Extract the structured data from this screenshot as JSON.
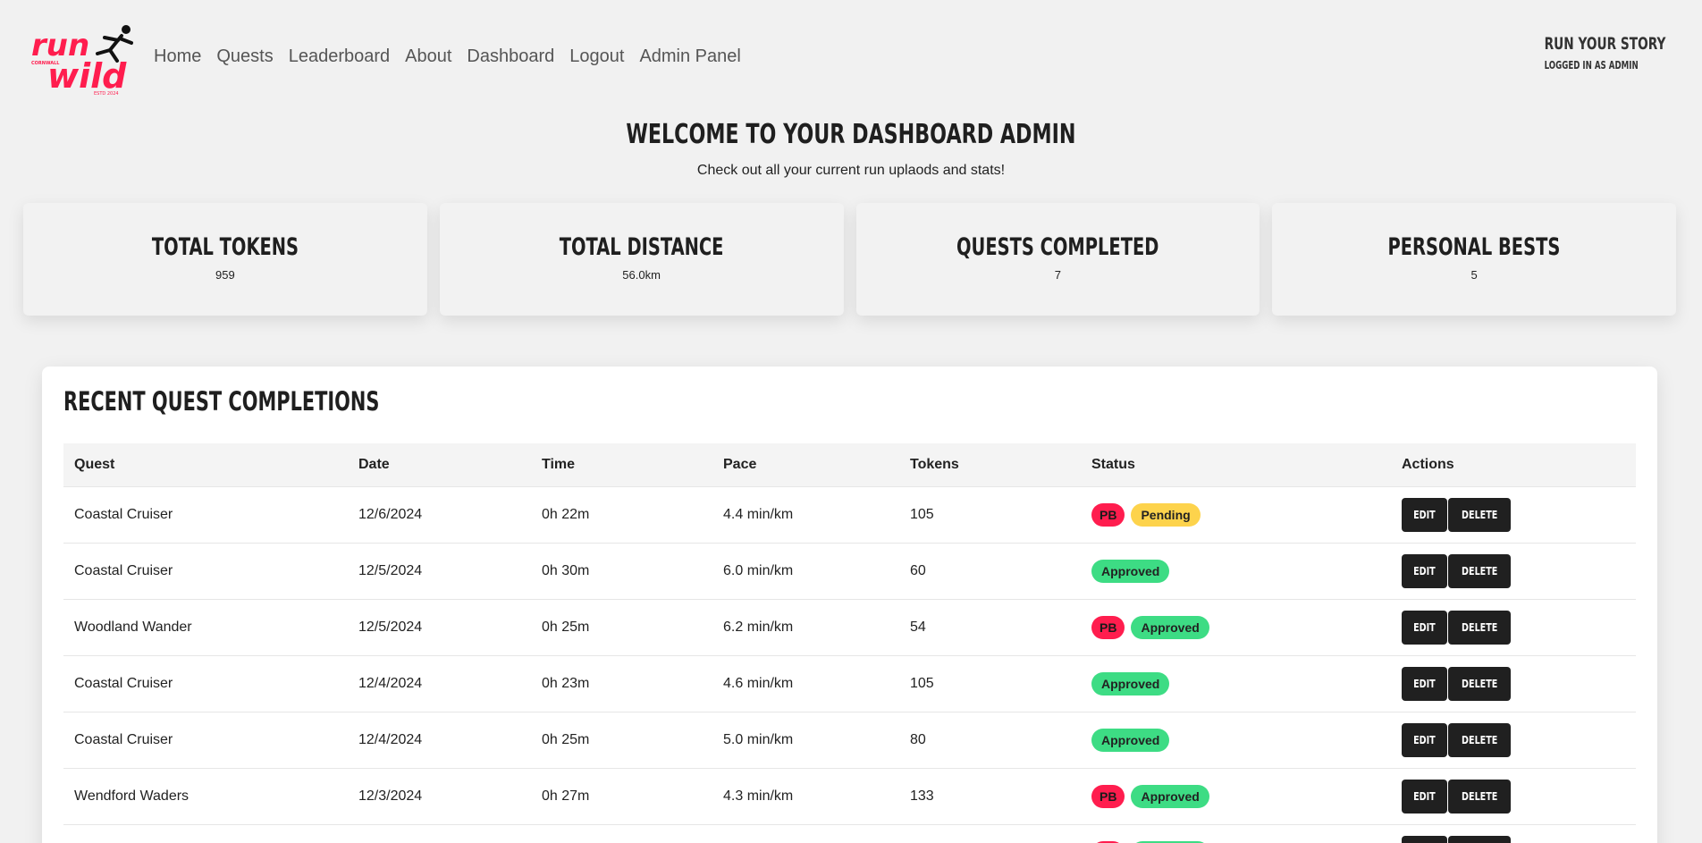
{
  "header": {
    "logo": {
      "line1": "run",
      "line2": "wild",
      "small_top": "CORNWALL",
      "small_bottom": "ESTD 2024"
    },
    "nav": [
      "Home",
      "Quests",
      "Leaderboard",
      "About",
      "Dashboard",
      "Logout",
      "Admin Panel"
    ],
    "brand_title": "RUN YOUR STORY",
    "brand_sub": "LOGGED IN AS ADMIN"
  },
  "welcome": {
    "title": "WELCOME TO YOUR DASHBOARD ADMIN",
    "subtitle": "Check out all your current run uplaods and stats!"
  },
  "stats": [
    {
      "label": "TOTAL TOKENS",
      "value": "959"
    },
    {
      "label": "TOTAL DISTANCE",
      "value": "56.0km"
    },
    {
      "label": "QUESTS COMPLETED",
      "value": "7"
    },
    {
      "label": "PERSONAL BESTS",
      "value": "5"
    }
  ],
  "recent": {
    "title": "RECENT QUEST COMPLETIONS",
    "columns": [
      "Quest",
      "Date",
      "Time",
      "Pace",
      "Tokens",
      "Status",
      "Actions"
    ],
    "edit_label": "EDIT",
    "delete_label": "DELETE",
    "rows": [
      {
        "quest": "Coastal Cruiser",
        "date": "12/6/2024",
        "time": "0h 22m",
        "pace": "4.4 min/km",
        "tokens": "105",
        "pb": "PB",
        "status": "Pending"
      },
      {
        "quest": "Coastal Cruiser",
        "date": "12/5/2024",
        "time": "0h 30m",
        "pace": "6.0 min/km",
        "tokens": "60",
        "pb": "",
        "status": "Approved"
      },
      {
        "quest": "Woodland Wander",
        "date": "12/5/2024",
        "time": "0h 25m",
        "pace": "6.2 min/km",
        "tokens": "54",
        "pb": "PB",
        "status": "Approved"
      },
      {
        "quest": "Coastal Cruiser",
        "date": "12/4/2024",
        "time": "0h 23m",
        "pace": "4.6 min/km",
        "tokens": "105",
        "pb": "",
        "status": "Approved"
      },
      {
        "quest": "Coastal Cruiser",
        "date": "12/4/2024",
        "time": "0h 25m",
        "pace": "5.0 min/km",
        "tokens": "80",
        "pb": "",
        "status": "Approved"
      },
      {
        "quest": "Wendford Waders",
        "date": "12/3/2024",
        "time": "0h 27m",
        "pace": "4.3 min/km",
        "tokens": "133",
        "pb": "PB",
        "status": "Approved"
      },
      {
        "quest": "",
        "date": "",
        "time": "",
        "pace": "",
        "tokens": "",
        "pb": "PB",
        "status": "Approved"
      }
    ]
  },
  "colors": {
    "brand_red": "#ff1d4e",
    "pending": "#fdd34c",
    "approved": "#3ddc84",
    "button": "#202020"
  }
}
